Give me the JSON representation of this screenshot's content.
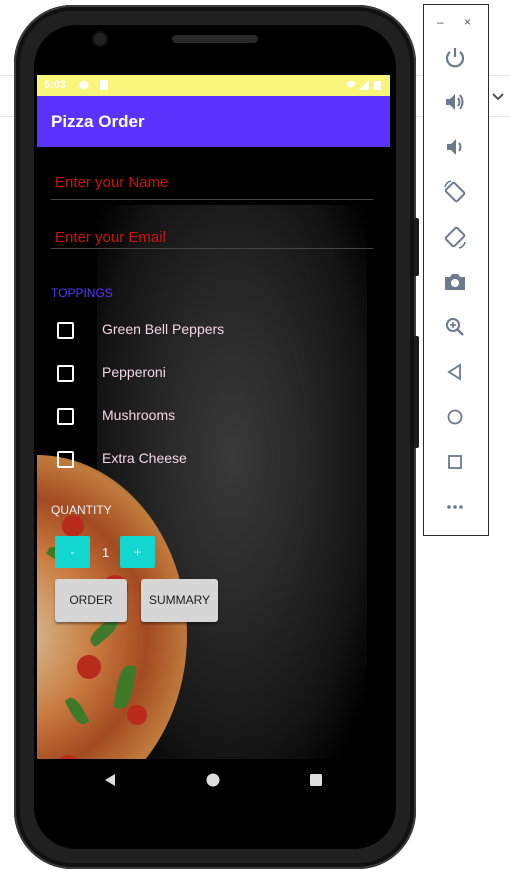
{
  "emulator_panel": {
    "minimize": "–",
    "close": "×",
    "controls": [
      {
        "name": "power-icon"
      },
      {
        "name": "volume-up-icon"
      },
      {
        "name": "volume-down-icon"
      },
      {
        "name": "rotate-left-icon"
      },
      {
        "name": "rotate-right-icon"
      },
      {
        "name": "camera-icon"
      },
      {
        "name": "zoom-icon"
      },
      {
        "name": "back-icon"
      },
      {
        "name": "home-icon"
      },
      {
        "name": "overview-icon"
      },
      {
        "name": "more-icon"
      }
    ]
  },
  "status_bar": {
    "time": "5:03"
  },
  "app_bar": {
    "title": "Pizza Order"
  },
  "form": {
    "name_hint": "Enter your Name",
    "email_hint": "Enter your Email",
    "toppings_header": "TOPPINGS",
    "toppings": [
      {
        "label": "Green Bell Peppers",
        "checked": false
      },
      {
        "label": "Pepperoni",
        "checked": false
      },
      {
        "label": "Mushrooms",
        "checked": false
      },
      {
        "label": "Extra Cheese",
        "checked": false
      }
    ],
    "quantity_header": "QUANTITY",
    "decrement_label": "-",
    "quantity_value": "1",
    "increment_label": "+",
    "order_label": "ORDER",
    "summary_label": "SUMMARY"
  },
  "colors": {
    "accent": "#5b33ff",
    "status_bar": "#f9f57a",
    "hint_text": "#cc1111",
    "quantity_buttons": "#14d6d0",
    "section_header": "#5b33ff"
  }
}
